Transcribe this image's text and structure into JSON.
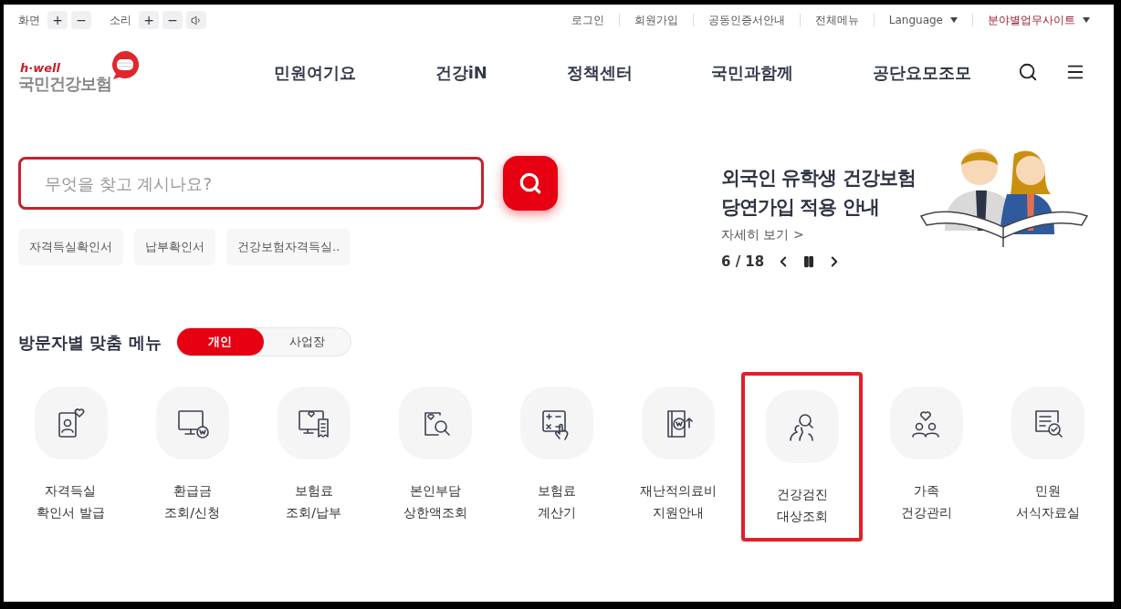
{
  "accessibility": {
    "screen_label": "화면",
    "sound_label": "소리",
    "plus": "+",
    "minus": "−"
  },
  "top_links": [
    {
      "label": "로그인",
      "kind": "link"
    },
    {
      "label": "회원가입",
      "kind": "link"
    },
    {
      "label": "공동인증서안내",
      "kind": "link"
    },
    {
      "label": "전체메뉴",
      "kind": "link"
    },
    {
      "label": "Language",
      "kind": "dropdown"
    },
    {
      "label": "분야별업무사이트",
      "kind": "dropdown-accent"
    }
  ],
  "logo": {
    "tagline": "h·well",
    "name": "국민건강보험"
  },
  "nav": [
    "민원여기요",
    "건강iN",
    "정책센터",
    "국민과함께",
    "공단요모조모"
  ],
  "search": {
    "placeholder": "무엇을 찾고 계시나요?"
  },
  "quick_keywords": [
    "자격득실확인서",
    "납부확인서",
    "건강보험자격득실.."
  ],
  "banner": {
    "title_lines": [
      "외국인 유학생 건강보험",
      "당연가입 적용 안내"
    ],
    "link": "자세히 보기 >",
    "counter": "6 / 18"
  },
  "visitor_menu": {
    "title": "방문자별 맞춤 메뉴",
    "tabs": [
      {
        "label": "개인",
        "selected": true
      },
      {
        "label": "사업장",
        "selected": false
      }
    ],
    "items": [
      {
        "label": "자격득실\n확인서 발급",
        "highlighted": false
      },
      {
        "label": "환급금\n조회/신청",
        "highlighted": false
      },
      {
        "label": "보험료\n조회/납부",
        "highlighted": false
      },
      {
        "label": "본인부담\n상한액조회",
        "highlighted": false
      },
      {
        "label": "보험료\n계산기",
        "highlighted": false
      },
      {
        "label": "재난적의료비\n지원안내",
        "highlighted": false
      },
      {
        "label": "건강검진\n대상조회",
        "highlighted": true
      },
      {
        "label": "가족\n건강관리",
        "highlighted": false
      },
      {
        "label": "민원\n서식자료실",
        "highlighted": false
      }
    ]
  }
}
